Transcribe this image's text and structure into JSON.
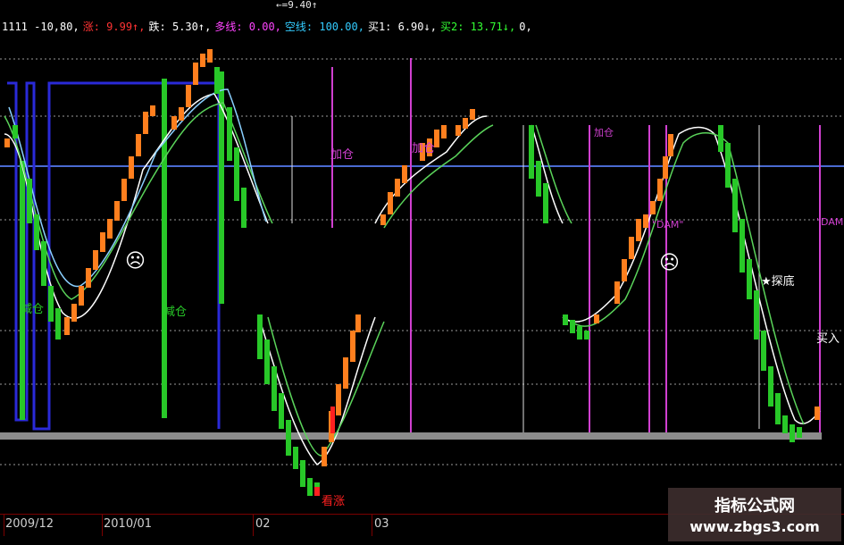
{
  "title_stub": "←=9.40↑",
  "indicator_line": [
    {
      "text": "1111 -10,80,",
      "color": "#ffffff"
    },
    {
      "text": "涨: 9.99↑,",
      "color": "#ff3333"
    },
    {
      "text": "跌: 5.30↑,",
      "color": "#ffffff"
    },
    {
      "text": "多线: 0.00,",
      "color": "#ff44ff"
    },
    {
      "text": "空线: 100.00,",
      "color": "#33ccff"
    },
    {
      "text": "买1: 6.90↓,",
      "color": "#ffffff"
    },
    {
      "text": "买2: 13.71↓,",
      "color": "#33ff33"
    },
    {
      "text": "0,",
      "color": "#ffffff"
    }
  ],
  "signals": {
    "jiancang_1": "减仓",
    "jiancang_2": "减仓",
    "jiacang_1": "加仓",
    "jiacang_2": "加仓",
    "jiacang_3": "加仓",
    "kanzhang": "看涨",
    "tandi": "★探底",
    "mairu": "买入",
    "dam_1": "\"DAM\"",
    "dam_2": "\"DAM\"",
    "smiley": "☹",
    "face_mid": "☹"
  },
  "dates": [
    "2009/12",
    "2010/01",
    "02",
    "03"
  ],
  "watermark": {
    "line1": "指标公式网",
    "line2": "www.zbgs3.com"
  },
  "colors": {
    "up_candle": "#ff7f1e",
    "down_candle": "#28c828",
    "ma_white": "#ffffff",
    "ma_green": "#5ad35a",
    "blue_line": "#2a2aaa",
    "horizontal_blue": "#4a6ad0",
    "magenta": "#d040d0",
    "grey_base": "#8c8c8c"
  }
}
